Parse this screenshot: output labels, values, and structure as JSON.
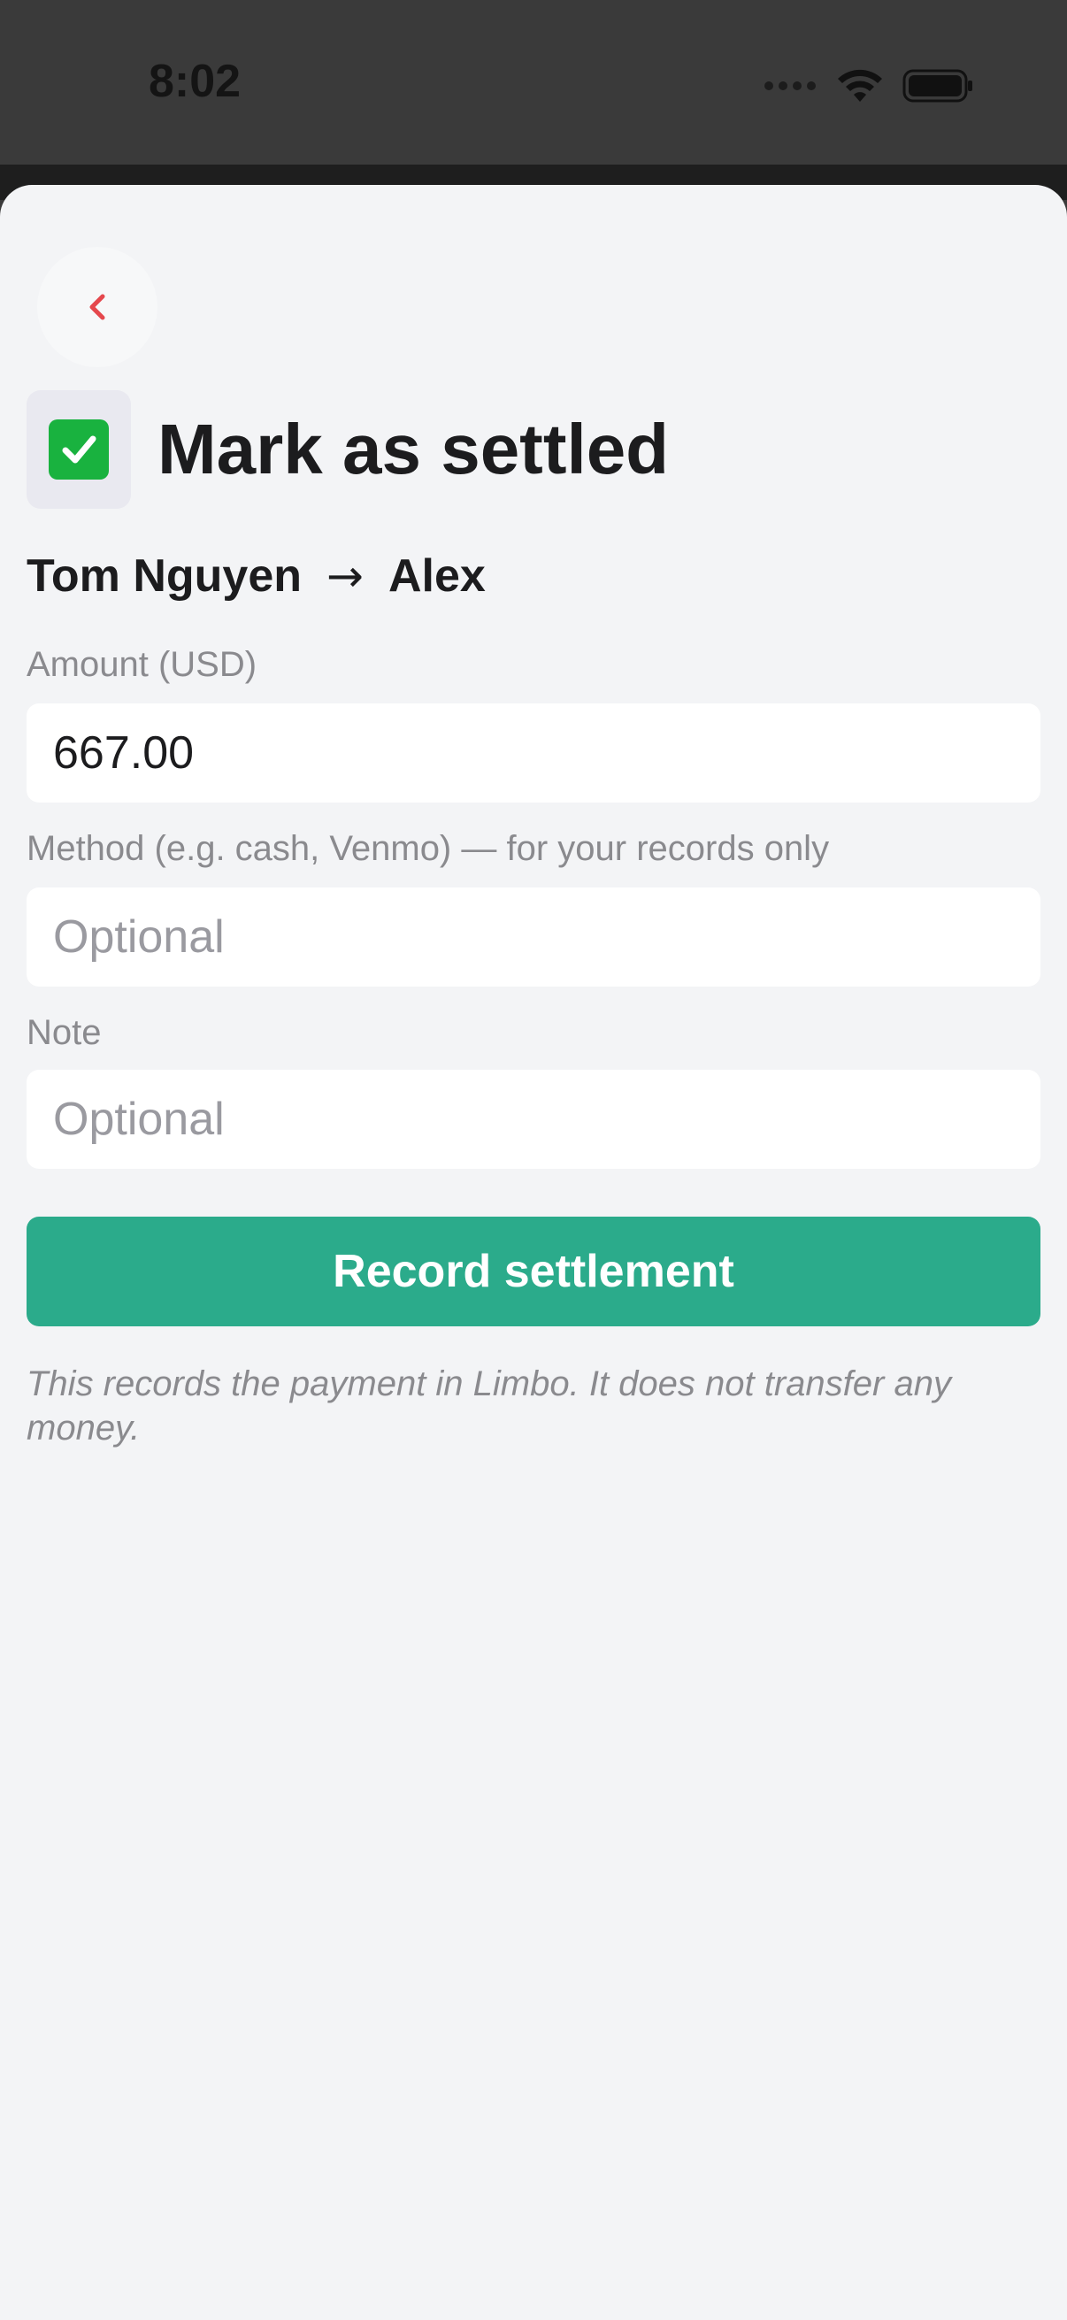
{
  "status_bar": {
    "time": "8:02"
  },
  "header": {
    "back_icon": "chevron-left-icon",
    "title_icon": "check-mark-box-icon",
    "title": "Mark as settled"
  },
  "settlement": {
    "from": "Tom Nguyen",
    "arrow": "→",
    "to": "Alex"
  },
  "form": {
    "amount_label": "Amount (USD)",
    "amount_value": "667.00",
    "method_label": "Method (e.g. cash, Venmo) — for your records only",
    "method_placeholder": "Optional",
    "note_label": "Note",
    "note_placeholder": "Optional",
    "submit_label": "Record settlement"
  },
  "disclaimer": "This records the payment in Limbo. It does not transfer any money.",
  "colors": {
    "accent": "#2bab8b",
    "check": "#19b23f",
    "back_chevron": "#e5484d"
  }
}
